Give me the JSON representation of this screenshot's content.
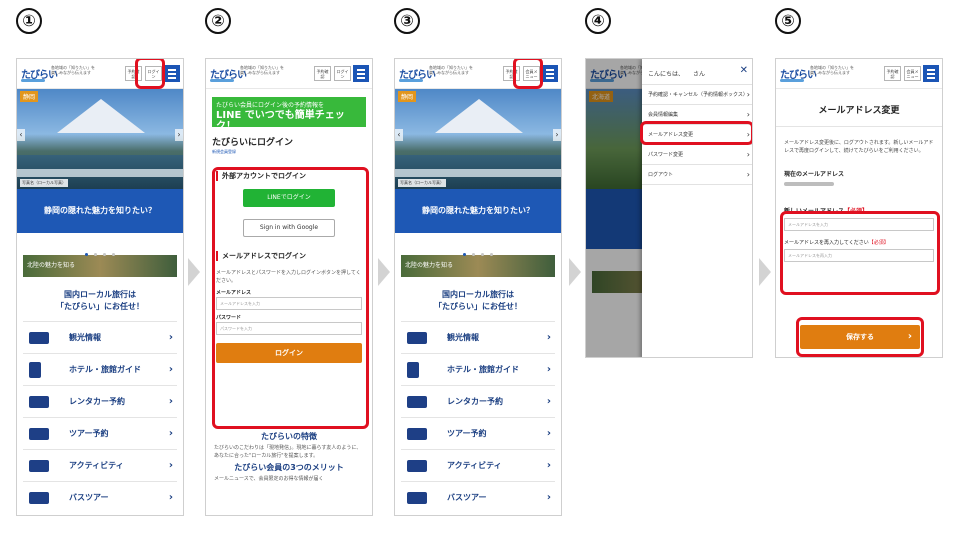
{
  "steps": [
    "①",
    "②",
    "③",
    "④",
    "⑤"
  ],
  "common": {
    "logo": "たびらい",
    "tagline": "各地域の「知りたい」を　楽しみながら伝えます",
    "login_btn": "ログイン",
    "reserve_btn": "予約確認",
    "member_btn": "会員メニュー"
  },
  "home": {
    "pref_badge": "静岡",
    "hero_caption": "写真名（ローカル写真）",
    "banner": "静岡の隠れた魅力を知りたい？",
    "promo": "北陸の魅力を知る",
    "intro_line1": "国内ローカル旅行は",
    "intro_line2": "「たびらい」にお任せ！",
    "categories": [
      "観光情報",
      "ホテル・旅館ガイド",
      "レンタカー予約",
      "ツアー予約",
      "アクティビティ",
      "バスツアー"
    ]
  },
  "login": {
    "line_banner_top": "たびらい会員にログイン後の予約情報を",
    "line_banner_main": "LINE でいつでも簡単チェック！",
    "title": "たびらいにログイン",
    "register_link": "新規会員登録",
    "ext_heading": "外部アカウントでログイン",
    "line_btn": "LINEでログイン",
    "google_btn": "Sign in with Google",
    "mail_heading": "メールアドレスでログイン",
    "mail_desc": "メールアドレスとパスワードを入力しログインボタンを押してください。",
    "email_label": "メールアドレス",
    "email_placeholder": "メールアドレスを入力",
    "pw_label": "パスワード",
    "pw_placeholder": "パスワードを入力",
    "submit": "ログイン",
    "features_title": "たびらいの特徴",
    "features_text": "たびらいのこだわりは「現地発信」。現地に暮らす友人のように、あなたに合った\"ローカル旅行\"を提案します。",
    "merits_title": "たびらい会員の3つのメリット",
    "merit_first": "メールニュースで、会員限定のお得な情報が届く"
  },
  "menu": {
    "pref_badge": "北海道",
    "greeting": "こんにちは、　　さん",
    "items": [
      "予約確認・キャンセル（予約情報ボックス）",
      "会員情報編集",
      "メールアドレス変更",
      "パスワード変更",
      "ログアウト"
    ]
  },
  "email_change": {
    "title": "メールアドレス変更",
    "desc": "メールアドレス変更後に、ログアウトされます。新しいメールアドレスで再度ログインして、続けてたびらいをご利用ください。",
    "current_label": "現在のメールアドレス",
    "new_label": "新しいメールアドレス",
    "required": "【必須】",
    "new_placeholder": "メールアドレスを入力",
    "confirm_label": "メールアドレスを再入力してください",
    "confirm_placeholder": "メールアドレスを再入力",
    "save": "保存する"
  },
  "colors": {
    "accent_red": "#e01020",
    "brand_blue": "#1e58b5",
    "orange": "#e07d10",
    "line_green": "#21b335"
  }
}
